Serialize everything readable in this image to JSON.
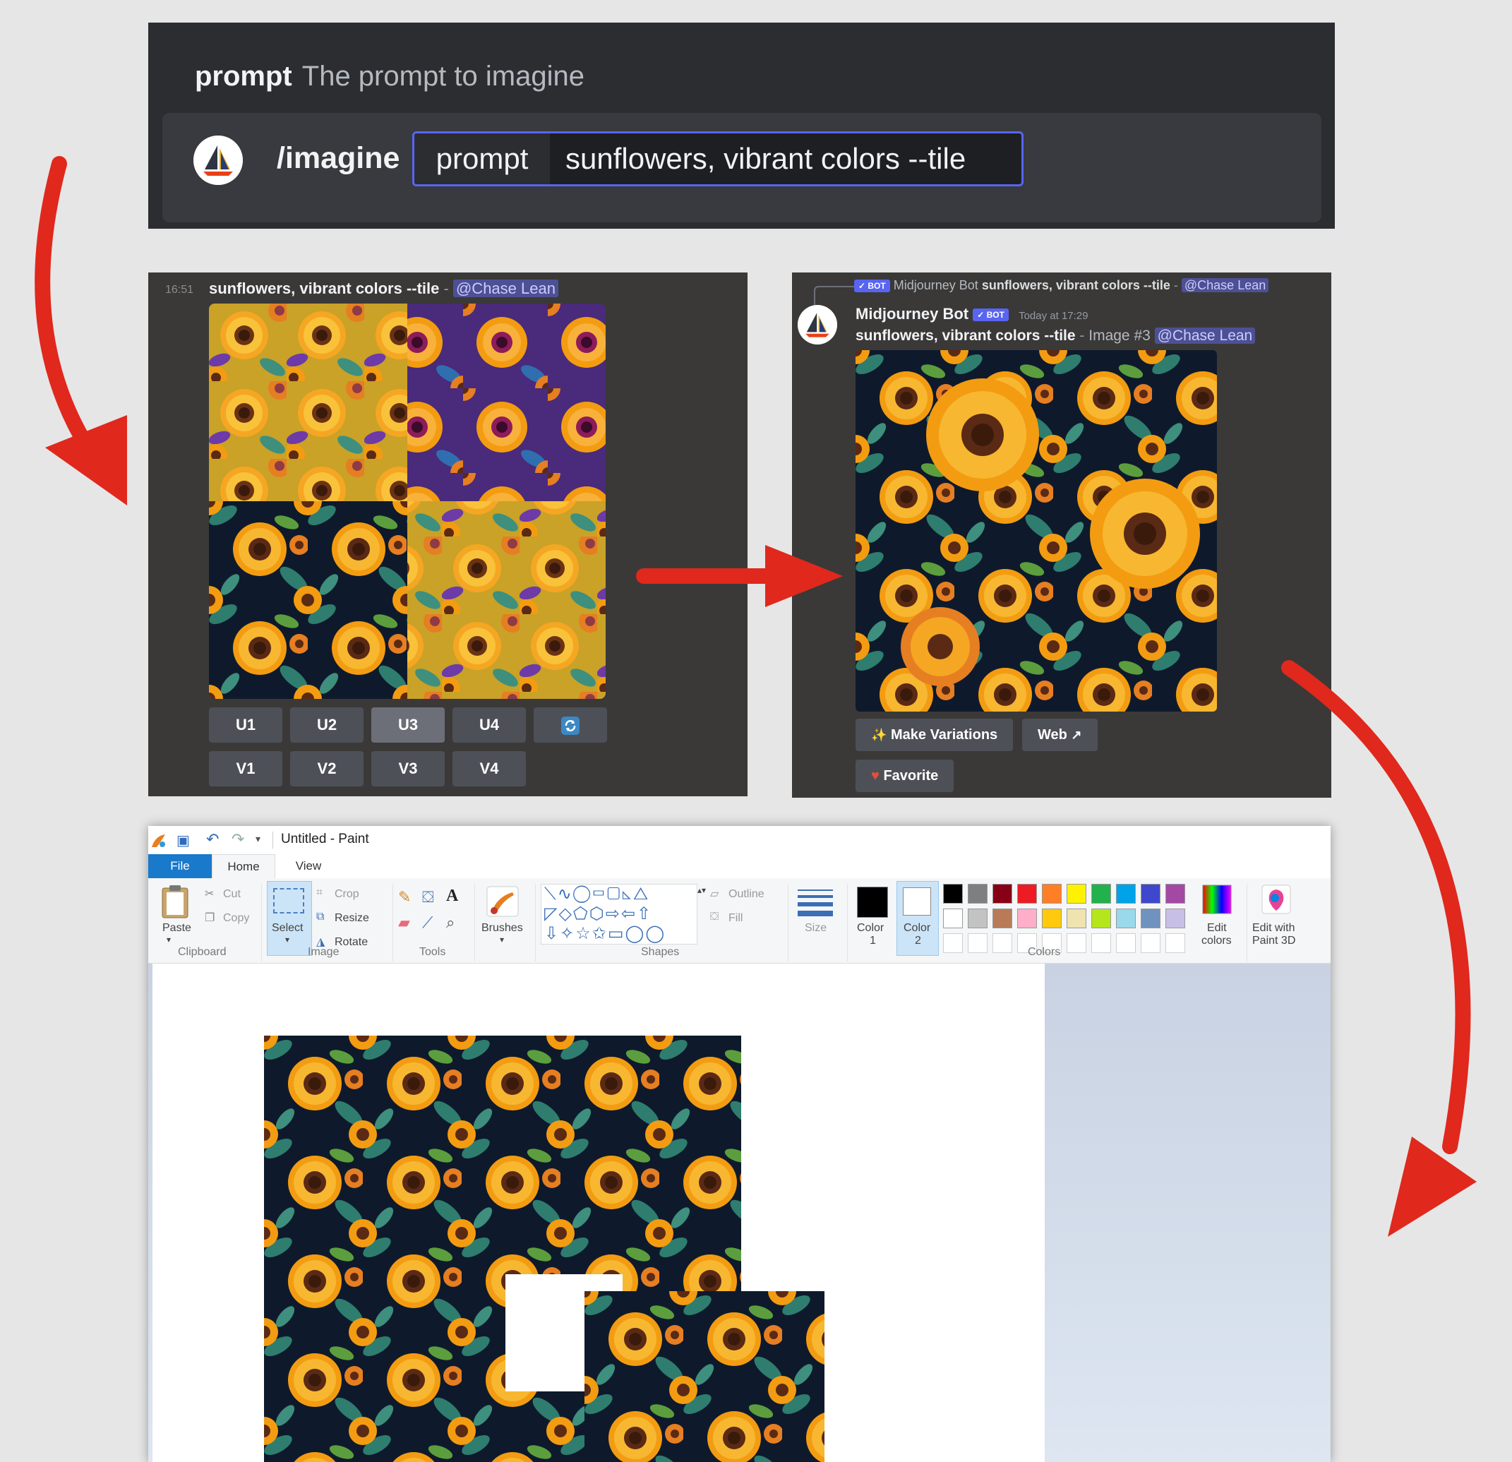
{
  "prompt_panel": {
    "option_label": "prompt",
    "option_description": "The prompt to imagine",
    "command": "/imagine",
    "field_name": "prompt",
    "field_value": "sunflowers, vibrant colors --tile"
  },
  "grid_message": {
    "time": "16:51",
    "prompt": "sunflowers, vibrant colors --tile",
    "separator": "-",
    "mention": "@Chase Lean",
    "buttons_row1": [
      "U1",
      "U2",
      "U3",
      "U4"
    ],
    "buttons_row2": [
      "V1",
      "V2",
      "V3",
      "V4"
    ],
    "active_button": "U3",
    "refresh_icon": "refresh-icon"
  },
  "upscale_message": {
    "reply_author": "Midjourney Bot",
    "reply_prompt": "sunflowers, vibrant colors --tile",
    "reply_mention": "@Chase Lean",
    "author": "Midjourney Bot",
    "bot_badge": "✓ BOT",
    "timestamp": "Today at 17:29",
    "prompt": "sunflowers, vibrant colors --tile",
    "separator": "-",
    "image_label": "Image #3",
    "mention": "@Chase Lean",
    "make_variations": "Make Variations",
    "web": "Web",
    "favorite": "Favorite"
  },
  "paint": {
    "title": "Untitled - Paint",
    "tabs": [
      "File",
      "Home",
      "View"
    ],
    "clipboard": {
      "paste": "Paste",
      "cut": "Cut",
      "copy": "Copy",
      "group": "Clipboard"
    },
    "image": {
      "select": "Select",
      "crop": "Crop",
      "resize": "Resize",
      "rotate": "Rotate",
      "group": "Image"
    },
    "tools": {
      "group": "Tools"
    },
    "brushes": "Brushes",
    "shapes": {
      "outline": "Outline",
      "fill": "Fill",
      "group": "Shapes"
    },
    "size": "Size",
    "color1": {
      "line1": "Color",
      "line2": "1"
    },
    "color2": {
      "line1": "Color",
      "line2": "2"
    },
    "colors_group": "Colors",
    "edit_colors": {
      "line1": "Edit",
      "line2": "colors"
    },
    "edit_paint3d": {
      "line1": "Edit with",
      "line2": "Paint 3D"
    },
    "palette_row1": [
      "#000000",
      "#7f7f7f",
      "#880015",
      "#ed1c24",
      "#ff7f27",
      "#fff200",
      "#22b14c",
      "#00a2e8",
      "#3f48cc",
      "#a349a4"
    ],
    "palette_row2": [
      "#ffffff",
      "#c3c3c3",
      "#b97a57",
      "#ffaec9",
      "#ffc90e",
      "#efe4b0",
      "#b5e61d",
      "#99d9ea",
      "#7092be",
      "#c8bfe7"
    ]
  },
  "accent_colors": {
    "discord_blurple": "#5865f2",
    "arrow_red": "#e0281d",
    "paint_file_tab": "#1979ca"
  }
}
